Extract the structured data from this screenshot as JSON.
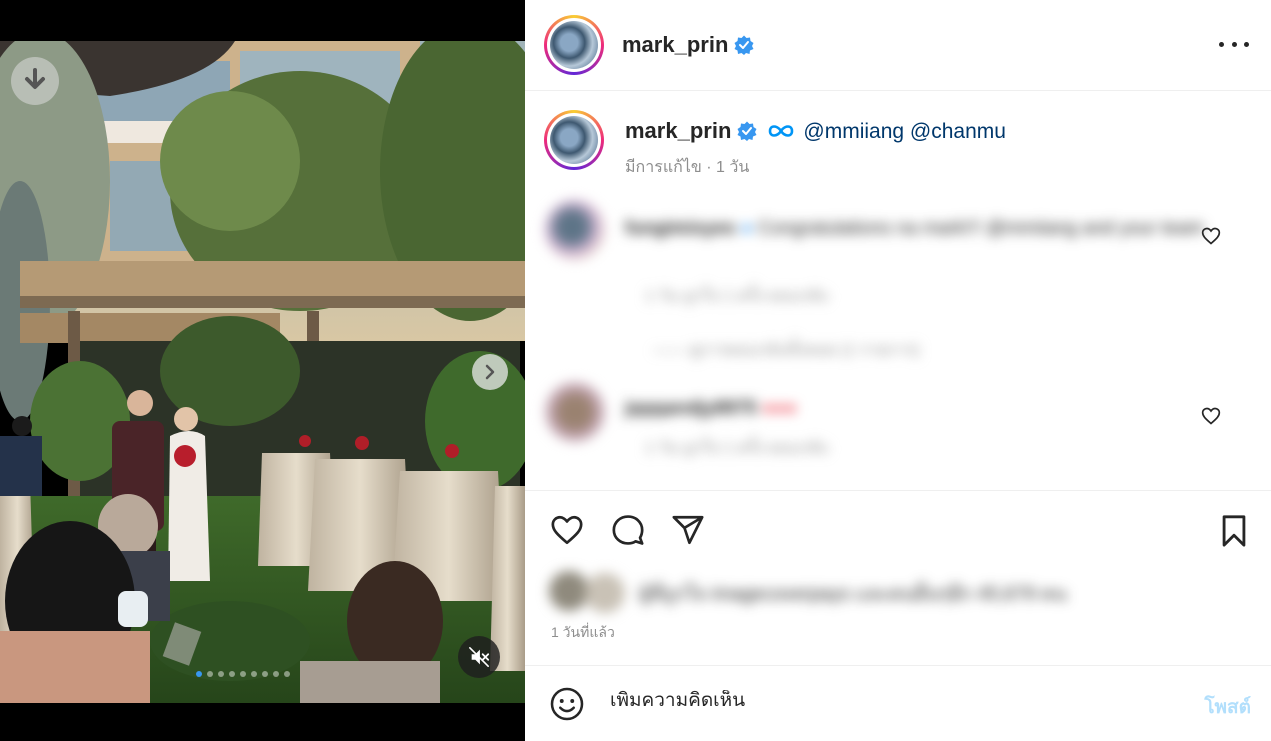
{
  "post": {
    "username": "mark_prin",
    "verified": true,
    "caption": {
      "username": "mark_prin",
      "mentions": [
        "@mmiiang",
        "@chanmu"
      ],
      "edited_label": "มีการแก้ไข",
      "separator": "·",
      "age": "1 วัน"
    },
    "comments": [
      {
        "user": "fungimisyes",
        "text": "Congratulations na mark!!! @mmiiang and your team",
        "meta": "1 วัน   ถูกใจ 1 ครั้ง   ตอบกลับ",
        "replies_label": "ดูการตอบกลับทั้งหมด (1 รายการ)"
      },
      {
        "user": "jqqqandjy8975",
        "text": "sunshine",
        "meta": "1 วัน   ถูกใจ 1 ครั้ง   ตอบกลับ"
      }
    ],
    "liked_by_text": "ผู้ที่ถูกใจ imagecoverpays และคนอื่นๆอีก 45,679 คน",
    "posted_ago": "1 วันที่แล้ว",
    "comment_placeholder": "เพิ่มความคิดเห็น",
    "post_button": "โพสต์",
    "carousel": {
      "slides": 9,
      "active_index": 0
    }
  },
  "colors": {
    "accent": "#0095f6",
    "verified": "#3897f0",
    "post_disabled": "#b2dffc"
  },
  "icons": [
    "download-icon",
    "chevron-right-icon",
    "muted-speaker-icon",
    "verified-badge-icon",
    "more-icon",
    "heart-icon",
    "comment-icon",
    "share-icon",
    "bookmark-icon",
    "emoji-icon"
  ]
}
